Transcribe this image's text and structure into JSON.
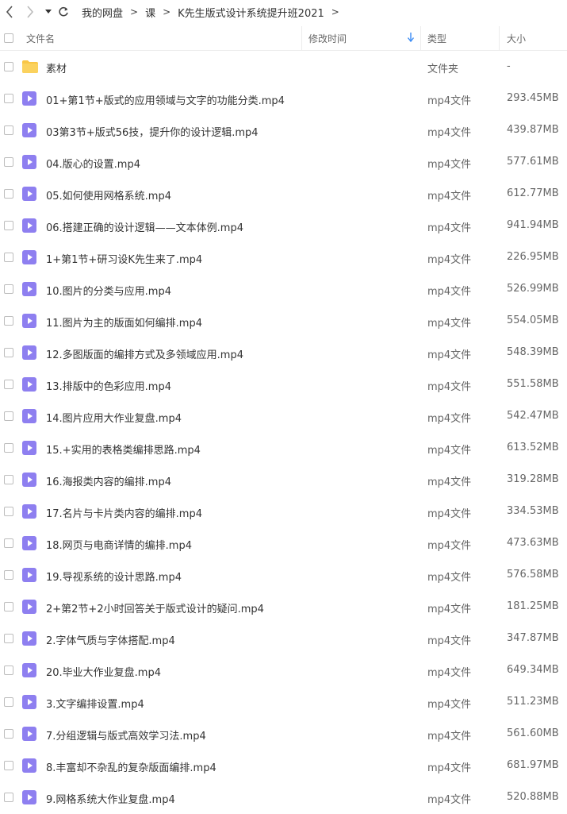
{
  "nav": {
    "breadcrumbs": [
      "我的网盘",
      "课",
      "K先生版式设计系统提升班2021"
    ],
    "separator": ">"
  },
  "header": {
    "name": "文件名",
    "mtime": "修改时间",
    "type": "类型",
    "size": "大小"
  },
  "colors": {
    "folder": "#f9c646",
    "video_icon": "#8e7ff0",
    "sort_arrow": "#3b8cf5"
  },
  "files": [
    {
      "name": "素材",
      "type": "文件夹",
      "size": "-",
      "icon": "folder-icon"
    },
    {
      "name": "01+第1节+版式的应用领域与文字的功能分类.mp4",
      "type": "mp4文件",
      "size": "293.45MB",
      "icon": "video-icon"
    },
    {
      "name": "03第3节+版式56技，提升你的设计逻辑.mp4",
      "type": "mp4文件",
      "size": "439.87MB",
      "icon": "video-icon"
    },
    {
      "name": "04.版心的设置.mp4",
      "type": "mp4文件",
      "size": "577.61MB",
      "icon": "video-icon"
    },
    {
      "name": "05.如何使用网格系统.mp4",
      "type": "mp4文件",
      "size": "612.77MB",
      "icon": "video-icon"
    },
    {
      "name": "06.搭建正确的设计逻辑——文本体例.mp4",
      "type": "mp4文件",
      "size": "941.94MB",
      "icon": "video-icon"
    },
    {
      "name": "1+第1节+研习设K先生来了.mp4",
      "type": "mp4文件",
      "size": "226.95MB",
      "icon": "video-icon"
    },
    {
      "name": "10.图片的分类与应用.mp4",
      "type": "mp4文件",
      "size": "526.99MB",
      "icon": "video-icon"
    },
    {
      "name": "11.图片为主的版面如何编排.mp4",
      "type": "mp4文件",
      "size": "554.05MB",
      "icon": "video-icon"
    },
    {
      "name": "12.多图版面的编排方式及多领域应用.mp4",
      "type": "mp4文件",
      "size": "548.39MB",
      "icon": "video-icon"
    },
    {
      "name": "13.排版中的色彩应用.mp4",
      "type": "mp4文件",
      "size": "551.58MB",
      "icon": "video-icon"
    },
    {
      "name": "14.图片应用大作业复盘.mp4",
      "type": "mp4文件",
      "size": "542.47MB",
      "icon": "video-icon"
    },
    {
      "name": "15.+实用的表格类编排思路.mp4",
      "type": "mp4文件",
      "size": "613.52MB",
      "icon": "video-icon"
    },
    {
      "name": "16.海报类内容的编排.mp4",
      "type": "mp4文件",
      "size": "319.28MB",
      "icon": "video-icon"
    },
    {
      "name": "17.名片与卡片类内容的编排.mp4",
      "type": "mp4文件",
      "size": "334.53MB",
      "icon": "video-icon"
    },
    {
      "name": "18.网页与电商详情的编排.mp4",
      "type": "mp4文件",
      "size": "473.63MB",
      "icon": "video-icon"
    },
    {
      "name": "19.导视系统的设计思路.mp4",
      "type": "mp4文件",
      "size": "576.58MB",
      "icon": "video-icon"
    },
    {
      "name": "2+第2节+2小时回答关于版式设计的疑问.mp4",
      "type": "mp4文件",
      "size": "181.25MB",
      "icon": "video-icon"
    },
    {
      "name": "2.字体气质与字体搭配.mp4",
      "type": "mp4文件",
      "size": "347.87MB",
      "icon": "video-icon"
    },
    {
      "name": "20.毕业大作业复盘.mp4",
      "type": "mp4文件",
      "size": "649.34MB",
      "icon": "video-icon"
    },
    {
      "name": "3.文字编排设置.mp4",
      "type": "mp4文件",
      "size": "511.23MB",
      "icon": "video-icon"
    },
    {
      "name": "7.分组逻辑与版式高效学习法.mp4",
      "type": "mp4文件",
      "size": "561.60MB",
      "icon": "video-icon"
    },
    {
      "name": "8.丰富却不杂乱的复杂版面编排.mp4",
      "type": "mp4文件",
      "size": "681.97MB",
      "icon": "video-icon"
    },
    {
      "name": "9.网格系统大作业复盘.mp4",
      "type": "mp4文件",
      "size": "520.88MB",
      "icon": "video-icon"
    }
  ]
}
